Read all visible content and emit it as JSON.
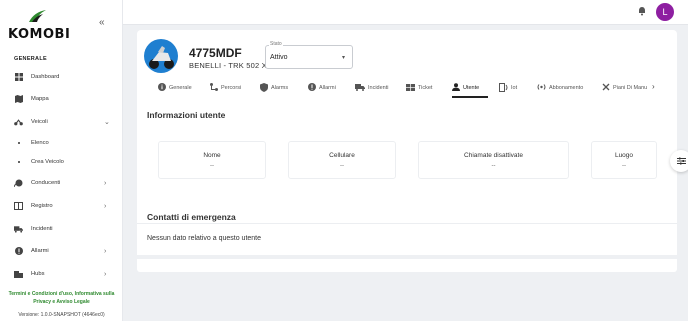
{
  "brand": {
    "name": "KOMOBI",
    "accent": "#2f8a2f"
  },
  "sidebar": {
    "section": "GENERALE",
    "items": [
      {
        "label": "Dashboard",
        "icon": "dashboard-icon"
      },
      {
        "label": "Mappa",
        "icon": "map-icon"
      },
      {
        "label": "Veicoli",
        "icon": "scooter-icon",
        "expanded": true
      },
      {
        "label": "Elenco",
        "sub": true
      },
      {
        "label": "Crea Veicolo",
        "sub": true
      },
      {
        "label": "Conducenti",
        "icon": "drivers-icon"
      },
      {
        "label": "Registro",
        "icon": "register-icon"
      },
      {
        "label": "Incidenti",
        "icon": "truck-icon"
      },
      {
        "label": "Allarmi",
        "icon": "alert-icon"
      },
      {
        "label": "Hubs",
        "icon": "hub-icon"
      }
    ],
    "footer_links": "Termini e Condizioni d'uso, Informativa sulla Privacy e Avviso Legale",
    "version": "Versione: 1.0.0-SNAPSHOT (4646ec0)"
  },
  "topbar": {
    "avatar_letter": "L",
    "avatar_color": "#8e1fa1"
  },
  "vehicle": {
    "plate": "4775MDF",
    "model": "BENELLI - TRK 502 X",
    "stato_label": "Stato",
    "stato_value": "Attivo"
  },
  "tabs": [
    {
      "label": "Generale",
      "icon": "info-icon"
    },
    {
      "label": "Percorsi",
      "icon": "route-icon"
    },
    {
      "label": "Alarms",
      "icon": "shield-icon"
    },
    {
      "label": "Allarmi",
      "icon": "alert-icon"
    },
    {
      "label": "Incidenti",
      "icon": "truck-icon"
    },
    {
      "label": "Ticket",
      "icon": "ticket-icon"
    },
    {
      "label": "Utente",
      "icon": "person-icon",
      "active": true
    },
    {
      "label": "Iot",
      "icon": "iot-icon"
    },
    {
      "label": "Abbonamento",
      "icon": "signal-icon"
    },
    {
      "label": "Piani Di Manu",
      "icon": "tools-icon"
    }
  ],
  "user_info": {
    "title": "Informazioni utente",
    "fields": [
      {
        "label": "Nome",
        "value": "--"
      },
      {
        "label": "Cellulare",
        "value": "--"
      },
      {
        "label": "Chiamate disattivate",
        "value": "--"
      },
      {
        "label": "Luogo",
        "value": "--"
      }
    ]
  },
  "emergency": {
    "title": "Contatti di emergenza",
    "empty_text": "Nessun dato relativo a questo utente"
  }
}
